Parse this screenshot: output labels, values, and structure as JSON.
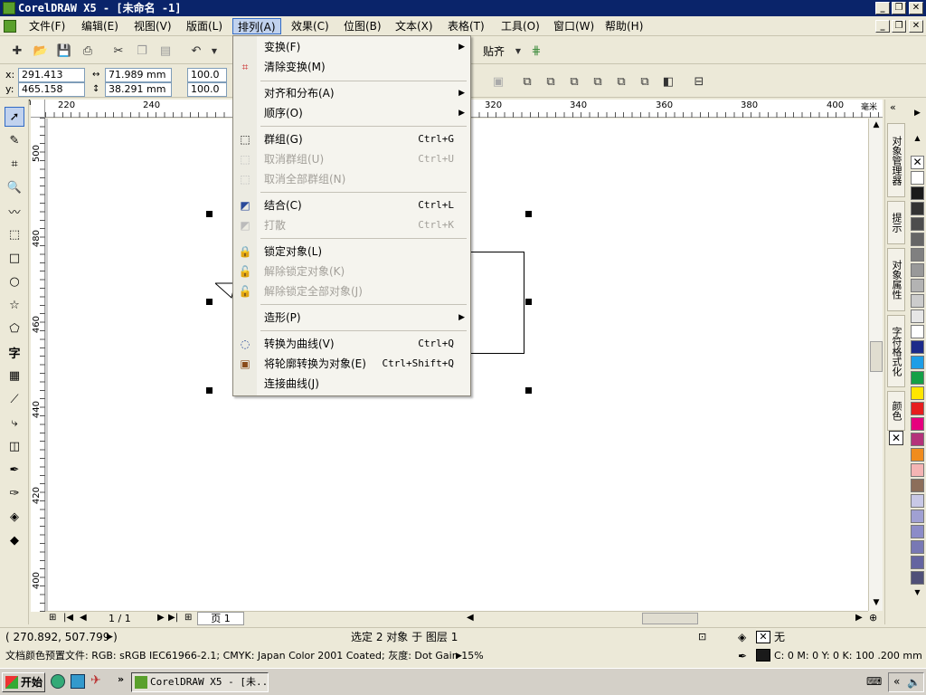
{
  "window": {
    "title": "CorelDRAW X5 - [未命名 -1]",
    "min": "_",
    "restore": "❐",
    "close": "✕"
  },
  "menubar": {
    "items": [
      {
        "id": "file",
        "label": "文件(F)"
      },
      {
        "id": "edit",
        "label": "编辑(E)"
      },
      {
        "id": "view",
        "label": "视图(V)"
      },
      {
        "id": "layout",
        "label": "版面(L)"
      },
      {
        "id": "arrange",
        "label": "排列(A)"
      },
      {
        "id": "effects",
        "label": "效果(C)"
      },
      {
        "id": "bitmaps",
        "label": "位图(B)"
      },
      {
        "id": "text",
        "label": "文本(X)"
      },
      {
        "id": "table",
        "label": "表格(T)"
      },
      {
        "id": "tools",
        "label": "工具(O)"
      },
      {
        "id": "window",
        "label": "窗口(W)"
      },
      {
        "id": "help",
        "label": "帮助(H)"
      }
    ]
  },
  "toolbar": {
    "snap_label": "贴齐"
  },
  "properties": {
    "x_label": "x:",
    "x_value": "291.413 mm",
    "y_label": "y:",
    "y_value": "465.158 mm",
    "width_value": "71.989 mm",
    "height_value": "38.291 mm",
    "scale_x": "100.0",
    "scale_y": "100.0"
  },
  "ruler": {
    "top_ticks": [
      "220",
      "240",
      "320",
      "340",
      "360",
      "380",
      "400"
    ],
    "unit": "毫米",
    "left_ticks": [
      "500",
      "480",
      "460",
      "440",
      "420",
      "400"
    ]
  },
  "arrange_menu": {
    "items": [
      {
        "label": "变换(F)",
        "shortcut": "",
        "submenu": true,
        "disabled": false,
        "icon": ""
      },
      {
        "label": "清除变换(M)",
        "shortcut": "",
        "submenu": false,
        "disabled": false,
        "icon": "clear-transform-icon"
      },
      {
        "label": "对齐和分布(A)",
        "shortcut": "",
        "submenu": true,
        "disabled": false,
        "icon": ""
      },
      {
        "label": "顺序(O)",
        "shortcut": "",
        "submenu": true,
        "disabled": false,
        "icon": ""
      },
      {
        "label": "群组(G)",
        "shortcut": "Ctrl+G",
        "submenu": false,
        "disabled": false,
        "icon": "group-icon"
      },
      {
        "label": "取消群组(U)",
        "shortcut": "Ctrl+U",
        "submenu": false,
        "disabled": true,
        "icon": "ungroup-icon"
      },
      {
        "label": "取消全部群组(N)",
        "shortcut": "",
        "submenu": false,
        "disabled": true,
        "icon": "ungroup-all-icon"
      },
      {
        "label": "结合(C)",
        "shortcut": "Ctrl+L",
        "submenu": false,
        "disabled": false,
        "icon": "combine-icon"
      },
      {
        "label": "打散",
        "shortcut": "Ctrl+K",
        "submenu": false,
        "disabled": true,
        "icon": "break-apart-icon"
      },
      {
        "label": "锁定对象(L)",
        "shortcut": "",
        "submenu": false,
        "disabled": false,
        "icon": "lock-icon"
      },
      {
        "label": "解除锁定对象(K)",
        "shortcut": "",
        "submenu": false,
        "disabled": true,
        "icon": "unlock-icon"
      },
      {
        "label": "解除锁定全部对象(J)",
        "shortcut": "",
        "submenu": false,
        "disabled": true,
        "icon": "unlock-all-icon"
      },
      {
        "label": "造形(P)",
        "shortcut": "",
        "submenu": true,
        "disabled": false,
        "icon": ""
      },
      {
        "label": "转换为曲线(V)",
        "shortcut": "Ctrl+Q",
        "submenu": false,
        "disabled": false,
        "icon": "convert-curves-icon"
      },
      {
        "label": "将轮廓转换为对象(E)",
        "shortcut": "Ctrl+Shift+Q",
        "submenu": false,
        "disabled": false,
        "icon": "outline-to-object-icon"
      },
      {
        "label": "连接曲线(J)",
        "shortcut": "",
        "submenu": false,
        "disabled": false,
        "icon": ""
      }
    ]
  },
  "dockers": {
    "tabs": [
      "对象管理器",
      "提示",
      "对象属性",
      "字符格式化",
      "颜色"
    ]
  },
  "palette": {
    "colors": [
      "#ffffff",
      "#1a1a1a",
      "#333333",
      "#4d4d4d",
      "#666666",
      "#808080",
      "#999999",
      "#b3b3b3",
      "#cccccc",
      "#e6e6e6",
      "#ffffff",
      "#1c2a8a",
      "#1e9ee6",
      "#14a046",
      "#ffe600",
      "#e61e1e",
      "#e6007e",
      "#b4327a",
      "#f08c1e",
      "#f4b4b4",
      "#8c6e5a",
      "#c8c8e6",
      "#a0a0d2",
      "#8c8cc8",
      "#7878b4",
      "#6464a0",
      "#505078"
    ]
  },
  "page_nav": {
    "page_count": "1 / 1",
    "page_tab": "页 1"
  },
  "status": {
    "coords": "( 270.892, 507.799 )",
    "selection": "选定 2 对象 于 图层 1",
    "fill_label": "无",
    "profile": "文档颜色预置文件: RGB: sRGB IEC61966-2.1; CMYK: Japan Color 2001 Coated; 灰度: Dot Gain 15%",
    "outline": "C: 0 M: 0 Y: 0 K: 100  .200 mm"
  },
  "taskbar": {
    "start": "开始",
    "task": "CorelDRAW X5 - [未..."
  }
}
